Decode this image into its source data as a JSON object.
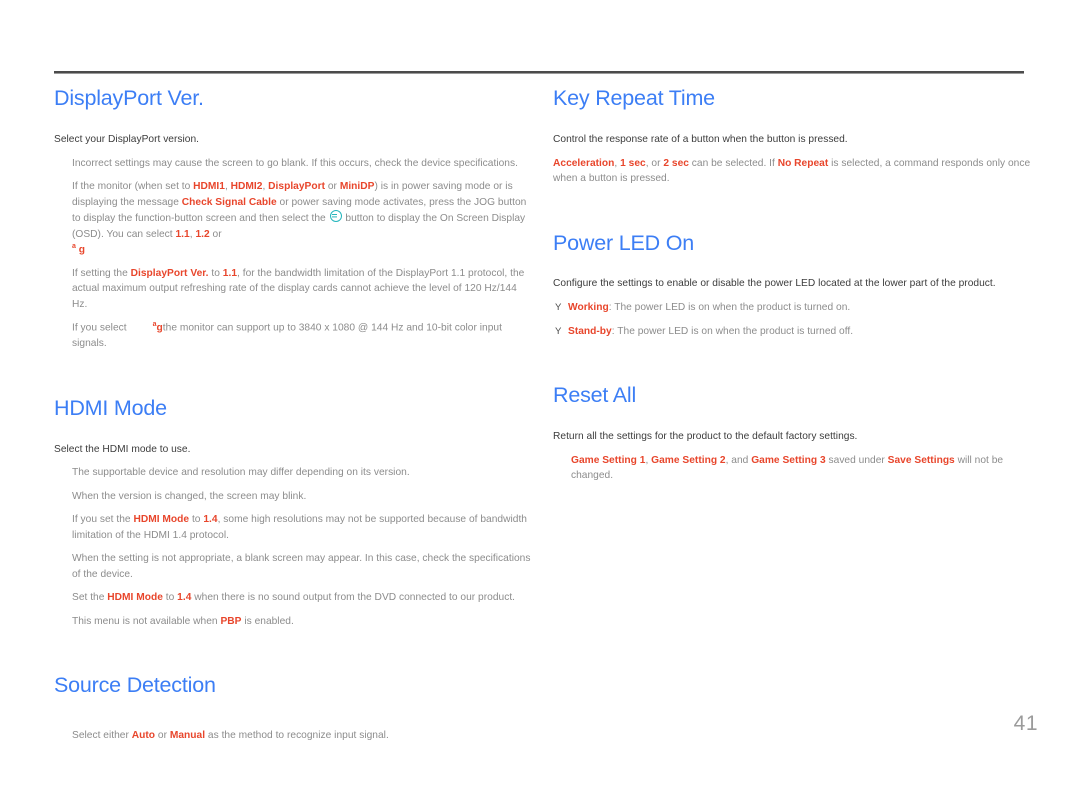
{
  "page": {
    "number": "41",
    "accent_blue": "#3c7ef5",
    "accent_red": "#e8462c",
    "body_gray": "#8c8c8c",
    "lead_gray": "#3c3c3c",
    "icon_teal": "#25b6bd"
  },
  "left_column": {
    "sections": [
      {
        "title": "DisplayPort Ver.",
        "lead": "Select your DisplayPort version.",
        "bullets": [
          {
            "marker": "",
            "parts": [
              {
                "t": "Incorrect settings may cause the screen to go blank. If this occurs, check the device specifications.",
                "s": "n"
              }
            ]
          },
          {
            "marker": "",
            "parts": [
              {
                "t": "If the monitor (when set to ",
                "s": "n"
              },
              {
                "t": "HDMI1",
                "s": "h"
              },
              {
                "t": ", ",
                "s": "n"
              },
              {
                "t": "HDMI2",
                "s": "h"
              },
              {
                "t": ", ",
                "s": "n"
              },
              {
                "t": "DisplayPort",
                "s": "h"
              },
              {
                "t": " or ",
                "s": "n"
              },
              {
                "t": "MiniDP",
                "s": "h"
              },
              {
                "t": ") is in power saving mode or is displaying the message ",
                "s": "n"
              },
              {
                "t": "Check Signal Cable",
                "s": "h"
              },
              {
                "t": " or power saving mode activates, press the JOG button to display the function-button screen and then select the ",
                "s": "n"
              },
              {
                "t": "",
                "s": "icon"
              },
              {
                "t": " button to display the On Screen Display (OSD). You can select ",
                "s": "n"
              },
              {
                "t": "1.1",
                "s": "h"
              },
              {
                "t": ", ",
                "s": "n"
              },
              {
                "t": "1.2",
                "s": "h"
              },
              {
                "t": " or",
                "s": "n"
              },
              {
                "t": "",
                "s": "br"
              },
              {
                "t": "  ",
                "s": "n"
              },
              {
                "t": "a",
                "s": "sup"
              },
              {
                "t": " g",
                "s": "g"
              }
            ]
          },
          {
            "marker": "",
            "parts": [
              {
                "t": "If setting the ",
                "s": "n"
              },
              {
                "t": "DisplayPort Ver.",
                "s": "h"
              },
              {
                "t": " to ",
                "s": "n"
              },
              {
                "t": "1.1",
                "s": "h"
              },
              {
                "t": ", for the bandwidth limitation of the DisplayPort 1.1 protocol, the actual maximum output refreshing rate of the display cards cannot achieve the level of 120 Hz/144 Hz.",
                "s": "n"
              }
            ]
          },
          {
            "marker": "",
            "parts": [
              {
                "t": "If you select",
                "s": "n"
              },
              {
                "t": "",
                "s": "gap"
              },
              {
                "t": "a",
                "s": "sup"
              },
              {
                "t": "g",
                "s": "g"
              },
              {
                "t": "the monitor can support up to 3840 x 1080 @ 144 Hz and 10-bit color input signals.",
                "s": "n"
              }
            ]
          }
        ]
      },
      {
        "title": "HDMI Mode",
        "lead": "Select the HDMI mode to use.",
        "bullets": [
          {
            "marker": "",
            "parts": [
              {
                "t": "The supportable device and resolution may differ depending on its version.",
                "s": "n"
              }
            ]
          },
          {
            "marker": "",
            "parts": [
              {
                "t": "When the version is changed, the screen may blink.",
                "s": "n"
              }
            ]
          },
          {
            "marker": "",
            "parts": [
              {
                "t": "If you set the ",
                "s": "n"
              },
              {
                "t": "HDMI Mode",
                "s": "h"
              },
              {
                "t": " to ",
                "s": "n"
              },
              {
                "t": "1.4",
                "s": "h"
              },
              {
                "t": ", some high resolutions may not be supported because of bandwidth limitation of the HDMI 1.4 protocol.",
                "s": "n"
              }
            ]
          },
          {
            "marker": "",
            "parts": [
              {
                "t": "When the setting is not appropriate, a blank screen may appear. In this case, check the specifications of the device.",
                "s": "n"
              }
            ]
          },
          {
            "marker": "",
            "parts": [
              {
                "t": "Set the ",
                "s": "n"
              },
              {
                "t": "HDMI Mode",
                "s": "h"
              },
              {
                "t": " to ",
                "s": "n"
              },
              {
                "t": "1.4",
                "s": "h"
              },
              {
                "t": " when there is no sound output from the DVD connected to our product.",
                "s": "n"
              }
            ]
          },
          {
            "marker": "",
            "parts": [
              {
                "t": "This menu is not available when ",
                "s": "n"
              },
              {
                "t": "PBP",
                "s": "h"
              },
              {
                "t": " is enabled.",
                "s": "n"
              }
            ]
          }
        ]
      },
      {
        "title": "Source Detection",
        "lead": "",
        "bullets": [
          {
            "marker": "",
            "parts": [
              {
                "t": "Select either ",
                "s": "n"
              },
              {
                "t": "Auto",
                "s": "h"
              },
              {
                "t": " or ",
                "s": "n"
              },
              {
                "t": "Manual",
                "s": "h"
              },
              {
                "t": " as the method to recognize input signal.",
                "s": "n"
              }
            ]
          }
        ]
      }
    ]
  },
  "right_column": {
    "sections": [
      {
        "title": "Key Repeat Time",
        "lead": "Control the response rate of a button when the button is pressed.",
        "bullets": [
          {
            "marker": "",
            "indent": "none",
            "parts": [
              {
                "t": "Acceleration",
                "s": "h"
              },
              {
                "t": ", ",
                "s": "n"
              },
              {
                "t": "1 sec",
                "s": "h"
              },
              {
                "t": ", or ",
                "s": "n"
              },
              {
                "t": "2 sec",
                "s": "h"
              },
              {
                "t": " can be selected. If ",
                "s": "n"
              },
              {
                "t": "No Repeat",
                "s": "h"
              },
              {
                "t": " is selected, a command responds only once when a button is pressed.",
                "s": "n"
              }
            ]
          }
        ]
      },
      {
        "title": "Power LED On",
        "lead": "Configure the settings to enable or disable the power LED located at the lower part of the product.",
        "bullets": [
          {
            "marker": "Y",
            "parts": [
              {
                "t": "Working",
                "s": "h"
              },
              {
                "t": ": The power LED is on when the product is turned on.",
                "s": "n"
              }
            ]
          },
          {
            "marker": "Y",
            "parts": [
              {
                "t": "Stand-by",
                "s": "h"
              },
              {
                "t": ": The power LED is on when the product is turned off.",
                "s": "n"
              }
            ]
          }
        ]
      },
      {
        "title": "Reset All",
        "lead": "Return all the settings for the product to the default factory settings.",
        "bullets": [
          {
            "marker": "",
            "parts": [
              {
                "t": "Game Setting 1",
                "s": "h"
              },
              {
                "t": ", ",
                "s": "n"
              },
              {
                "t": "Game Setting 2",
                "s": "h"
              },
              {
                "t": ", and ",
                "s": "n"
              },
              {
                "t": "Game Setting 3",
                "s": "h"
              },
              {
                "t": " saved under ",
                "s": "n"
              },
              {
                "t": "Save Settings",
                "s": "h"
              },
              {
                "t": " will not be changed.",
                "s": "n"
              }
            ]
          }
        ]
      }
    ]
  }
}
